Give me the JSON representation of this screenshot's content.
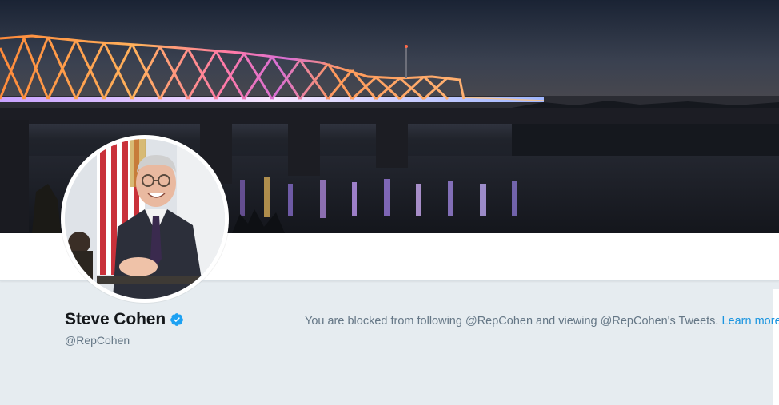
{
  "profile": {
    "name": "Steve Cohen",
    "handle": "@RepCohen",
    "verified": true
  },
  "notice": {
    "text": "You are blocked from following @RepCohen and viewing @RepCohen's Tweets.",
    "link_label": "Learn more"
  },
  "colors": {
    "background": "#e6ecf0",
    "link": "#1b95e0",
    "muted_text": "#657786",
    "name_text": "#14171a",
    "verified_badge": "#1da1f2"
  },
  "icons": {
    "verified": "verified-badge-icon"
  }
}
